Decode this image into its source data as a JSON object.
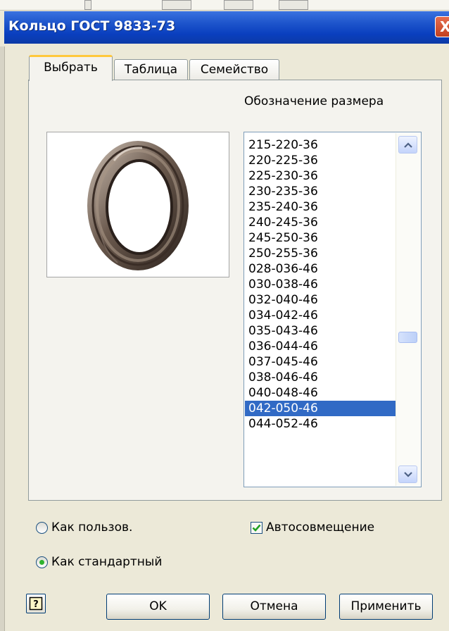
{
  "window": {
    "title": "Кольцо ГОСТ 9833-73",
    "close_glyph": "X"
  },
  "tabs": [
    "Выбрать",
    "Таблица",
    "Семейство"
  ],
  "active_tab": "Выбрать",
  "size_list": {
    "label": "Обозначение размера",
    "items": [
      "215-220-36",
      "220-225-36",
      "225-230-36",
      "230-235-36",
      "235-240-36",
      "240-245-36",
      "245-250-36",
      "250-255-36",
      "028-036-46",
      "030-038-46",
      "032-040-46",
      "034-042-46",
      "035-043-46",
      "036-044-46",
      "037-045-46",
      "038-046-46",
      "040-048-46",
      "042-050-46",
      "044-052-46"
    ],
    "selected": "042-050-46"
  },
  "placement": {
    "custom_label": "Как пользов.",
    "standard_label": "Как стандартный",
    "auto_label": "Автосовмещение",
    "auto_checked": true,
    "selected_option": "Как стандартный"
  },
  "buttons": {
    "ok": "OK",
    "cancel": "Отмена",
    "apply": "Применить",
    "help_icon": "help-icon"
  },
  "colors": {
    "titlebar": "#0a3fbf",
    "selection": "#316ac5",
    "tab_highlight": "#ffc83c"
  }
}
